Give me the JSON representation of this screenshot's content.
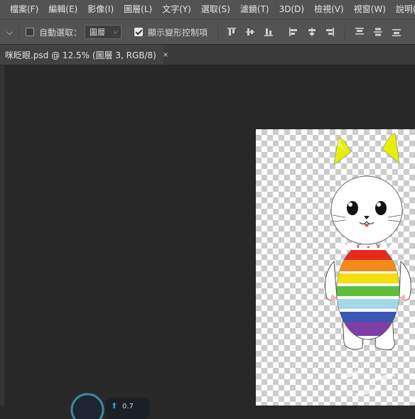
{
  "menu": {
    "items": [
      "檔案(F)",
      "編輯(E)",
      "影像(I)",
      "圖層(L)",
      "文字(Y)",
      "選取(S)",
      "濾鏡(T)",
      "3D(D)",
      "檢視(V)",
      "視窗(W)",
      "說明(H)"
    ]
  },
  "options": {
    "tool_dropdown_chevron": "⌵",
    "auto_select_label": "自動選取：",
    "auto_select_checked": false,
    "auto_select_target": "圖層",
    "transform_controls_label": "顯示變形控制項",
    "transform_controls_checked": true,
    "align_icons": [
      "align-top-icon",
      "align-vertical-center-icon",
      "align-bottom-icon",
      "align-left-icon",
      "align-horizontal-center-icon",
      "align-right-icon",
      "distribute-top-icon",
      "distribute-vertical-center-icon",
      "distribute-bottom-icon"
    ]
  },
  "document": {
    "tab_title": "咪眨眼.psd @ 12.5% (圖層 3, RGB/8)",
    "close_glyph": "×"
  },
  "status_widget": {
    "value_text": "0.7"
  },
  "colors": {
    "menubar": "#535353",
    "workspace": "#282828",
    "ears": "#e5f000",
    "stripes": [
      "#e52a1e",
      "#f28a1a",
      "#f6dd10",
      "#5fbf3a",
      "#a5d8e5",
      "#3a57b5",
      "#7d3fa6"
    ]
  }
}
